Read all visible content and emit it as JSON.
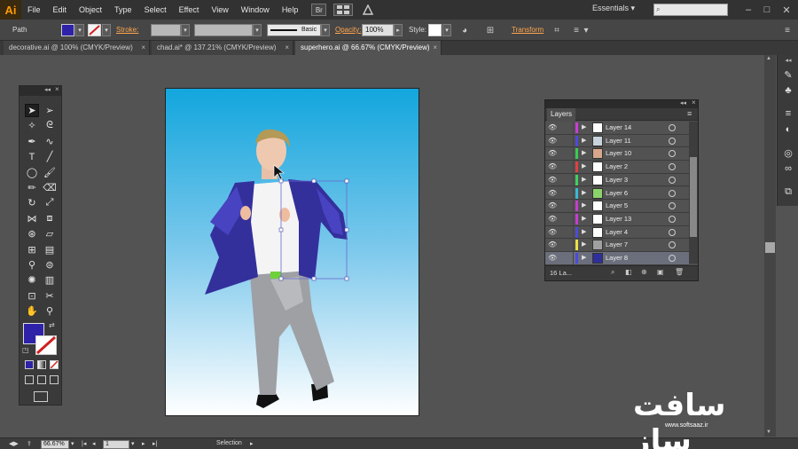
{
  "app": {
    "logo": "Ai"
  },
  "menubar": {
    "items": [
      "File",
      "Edit",
      "Object",
      "Type",
      "Select",
      "Effect",
      "View",
      "Window",
      "Help"
    ],
    "bridge_label": "Br",
    "workspace": "Essentials"
  },
  "controlbar": {
    "selection_type": "Path",
    "stroke_label": "Stroke:",
    "brush_label": "Basic",
    "opacity_label": "Opacity:",
    "opacity_value": "100%",
    "style_label": "Style:",
    "transform_label": "Transform"
  },
  "tabs": [
    {
      "label": "decorative.ai @ 100% (CMYK/Preview)",
      "active": false
    },
    {
      "label": "chad.ai* @ 137.21% (CMYK/Preview)",
      "active": false
    },
    {
      "label": "superhero.ai @ 66.67% (CMYK/Preview)",
      "active": true
    }
  ],
  "tools": [
    "selection-icon",
    "direct-selection-icon",
    "magic-wand-icon",
    "lasso-icon",
    "pen-icon",
    "curvature-icon",
    "type-icon",
    "line-icon",
    "ellipse-icon",
    "paintbrush-icon",
    "pencil-icon",
    "eraser-icon",
    "rotate-icon",
    "scale-icon",
    "width-icon",
    "free-transform-icon",
    "shape-builder-icon",
    "perspective-icon",
    "mesh-icon",
    "gradient-icon",
    "eyedropper-icon",
    "blend-icon",
    "symbol-sprayer-icon",
    "column-graph-icon",
    "artboard-icon",
    "slice-icon",
    "hand-icon",
    "zoom-icon"
  ],
  "layers_panel": {
    "tab": "Layers",
    "layers": [
      {
        "name": "Layer 14",
        "color": "#c83cd6",
        "thumb": "#ffffff",
        "active": false
      },
      {
        "name": "Layer 11",
        "color": "#4b4bd8",
        "thumb": "#c7d2dc",
        "active": false
      },
      {
        "name": "Layer 10",
        "color": "#3acb52",
        "thumb": "#d7a78b",
        "active": false
      },
      {
        "name": "Layer 2",
        "color": "#e04040",
        "thumb": "#ffffff",
        "active": false
      },
      {
        "name": "Layer 3",
        "color": "#40d060",
        "thumb": "#ffffff",
        "active": false
      },
      {
        "name": "Layer 6",
        "color": "#39b9d2",
        "thumb": "#8bd36a",
        "active": false
      },
      {
        "name": "Layer 5",
        "color": "#c53cd0",
        "thumb": "#ffffff",
        "active": false
      },
      {
        "name": "Layer 13",
        "color": "#c53cd0",
        "thumb": "#ffffff",
        "active": false
      },
      {
        "name": "Layer 4",
        "color": "#4b4bd8",
        "thumb": "#ffffff",
        "active": false
      },
      {
        "name": "Layer 7",
        "color": "#e8e048",
        "thumb": "#a0a0a0",
        "active": false
      },
      {
        "name": "Layer 8",
        "color": "#4b4bd8",
        "thumb": "#2f2f9a",
        "active": true
      }
    ],
    "count_label": "16 La..."
  },
  "statusbar": {
    "zoom": "66.67%",
    "artboard": "1",
    "tool_name": "Selection"
  },
  "colors": {
    "fill": "#2e22a8",
    "stroke": "#c0302e",
    "jacket": "#33309c",
    "pants": "#9ea0a4"
  },
  "watermark": {
    "main": "سافت ساز",
    "url": "www.softsaaz.ir"
  }
}
